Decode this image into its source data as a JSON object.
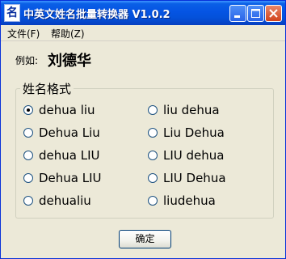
{
  "window": {
    "title": "中英文姓名批量转换器 V1.0.2",
    "icon_glyph": "名"
  },
  "menu": {
    "items": [
      {
        "label": "文件(F)"
      },
      {
        "label": "帮助(Z)"
      }
    ]
  },
  "example": {
    "label": "例如:",
    "name": "刘德华"
  },
  "group": {
    "title": "姓名格式",
    "options": [
      {
        "label": "dehua liu",
        "selected": true
      },
      {
        "label": "liu dehua",
        "selected": false
      },
      {
        "label": "Dehua Liu",
        "selected": false
      },
      {
        "label": "Liu Dehua",
        "selected": false
      },
      {
        "label": "dehua LIU",
        "selected": false
      },
      {
        "label": "LIU dehua",
        "selected": false
      },
      {
        "label": "Dehua LIU",
        "selected": false
      },
      {
        "label": "LIU Dehua",
        "selected": false
      },
      {
        "label": "dehualiu",
        "selected": false
      },
      {
        "label": "liudehua",
        "selected": false
      }
    ]
  },
  "buttons": {
    "ok": "确定"
  }
}
